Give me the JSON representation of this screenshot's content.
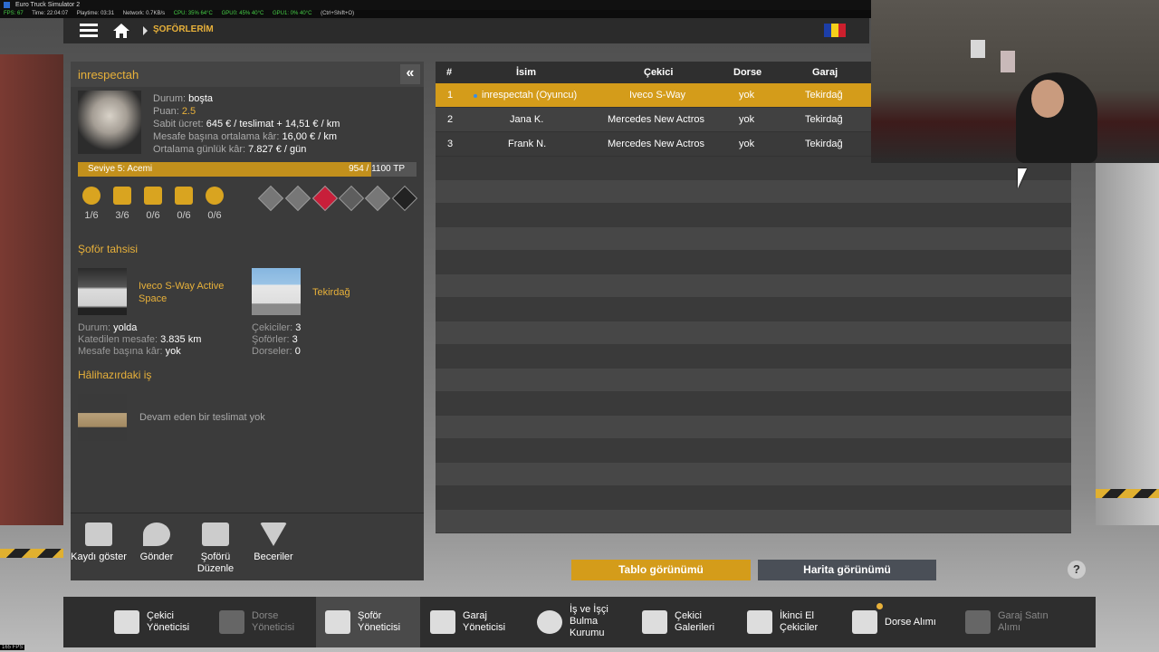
{
  "window": {
    "title": "Euro Truck Simulator 2",
    "app_icon": "ets2-icon"
  },
  "perf": [
    "FPS: 67",
    "Time: 22:04:07",
    "Playtime: 03:31",
    "Network: 0.7KB/s",
    "CPU: 35% 64°C",
    "GPU0: 45% 40°C",
    "GPU1: 0% 40°C",
    "(Ctrl+Shift+O)"
  ],
  "fps_corner": "165 FPS",
  "topnav": {
    "menu_icon": "hamburger-icon",
    "home_icon": "home-icon",
    "breadcrumb": "ŞOFÖRLERİM"
  },
  "driver": {
    "name": "inrespectah",
    "status_label": "Durum:",
    "status_value": "boşta",
    "rating_label": "Puan:",
    "rating_value": "2.5",
    "salary_label": "Sabit ücret:",
    "salary_value": "645 € / teslimat + 14,51 € / km",
    "avg_profit_label": "Mesafe başına ortalama kâr:",
    "avg_profit_value": "16,00 € / km",
    "daily_profit_label": "Ortalama günlük kâr:",
    "daily_profit_value": "7.827 € / gün",
    "level_label": "Seviye 5: Acemi",
    "level_progress": "954 / 1100 TP",
    "level_fraction": 0.867,
    "skills": [
      {
        "icon": "map-pin-icon",
        "value": "1/6"
      },
      {
        "icon": "heavy-cargo-icon",
        "value": "3/6"
      },
      {
        "icon": "fragile-cargo-icon",
        "value": "0/6"
      },
      {
        "icon": "urgent-cargo-icon",
        "value": "0/6"
      },
      {
        "icon": "eco-driving-icon",
        "value": "0/6"
      }
    ],
    "adr_icons": [
      "adr-explosive-icon",
      "adr-gas-icon",
      "adr-flammable-icon",
      "adr-toxic-icon",
      "adr-corrosive-icon",
      "adr-misc-icon"
    ]
  },
  "assignment": {
    "title": "Şoför tahsisi",
    "truck": "Iveco S-Way Active Space",
    "garage": "Tekirdağ",
    "truck_status_label": "Durum:",
    "truck_status_value": "yolda",
    "distance_label": "Katedilen mesafe:",
    "distance_value": "3.835 km",
    "profit_label": "Mesafe başına kâr:",
    "profit_value": "yok",
    "trucks_label": "Çekiciler:",
    "trucks_value": "3",
    "drivers_label": "Şoförler:",
    "drivers_value": "3",
    "trailers_label": "Dorseler:",
    "trailers_value": "0"
  },
  "current_job": {
    "title": "Hâlihazırdaki iş",
    "text": "Devam eden bir teslimat yok"
  },
  "actions": [
    {
      "label": "Kaydı göster",
      "icon": "records-icon"
    },
    {
      "label": "Gönder",
      "icon": "send-icon"
    },
    {
      "label": "Şoförü Düzenle",
      "icon": "edit-driver-icon"
    },
    {
      "label": "Beceriler",
      "icon": "skills-icon"
    }
  ],
  "table": {
    "headers": [
      "#",
      "İsim",
      "Çekici",
      "Dorse",
      "Garaj"
    ],
    "rows": [
      {
        "no": "1",
        "name": "inrespectah (Oyuncu)",
        "truck": "Iveco S-Way",
        "trailer": "yok",
        "garage": "Tekirdağ"
      },
      {
        "no": "2",
        "name": "Jana K.",
        "truck": "Mercedes New Actros",
        "trailer": "yok",
        "garage": "Tekirdağ"
      },
      {
        "no": "3",
        "name": "Frank N.",
        "truck": "Mercedes New Actros",
        "trailer": "yok",
        "garage": "Tekirdağ"
      }
    ]
  },
  "views": {
    "table": "Tablo görünümü",
    "map": "Harita görünümü"
  },
  "help": "?",
  "bottom_menu": [
    {
      "label": "Çekici Yöneticisi",
      "icon": "truck-manager-icon"
    },
    {
      "label": "Dorse Yöneticisi",
      "icon": "trailer-manager-icon"
    },
    {
      "label": "Şoför Yöneticisi",
      "icon": "driver-manager-icon"
    },
    {
      "label": "Garaj Yöneticisi",
      "icon": "garage-manager-icon"
    },
    {
      "label": "İş ve İşçi Bulma Kurumu",
      "icon": "recruitment-icon"
    },
    {
      "label": "Çekici Galerileri",
      "icon": "truck-dealer-icon"
    },
    {
      "label": "İkinci El Çekiciler",
      "icon": "used-trucks-icon"
    },
    {
      "label": "Dorse Alımı",
      "icon": "trailer-purchase-icon"
    },
    {
      "label": "Garaj Satın Alımı",
      "icon": "garage-purchase-icon"
    }
  ],
  "colors": {
    "accent": "#e8b13a",
    "selected_row": "#d49c1a",
    "panel": "#3b3b3b"
  }
}
